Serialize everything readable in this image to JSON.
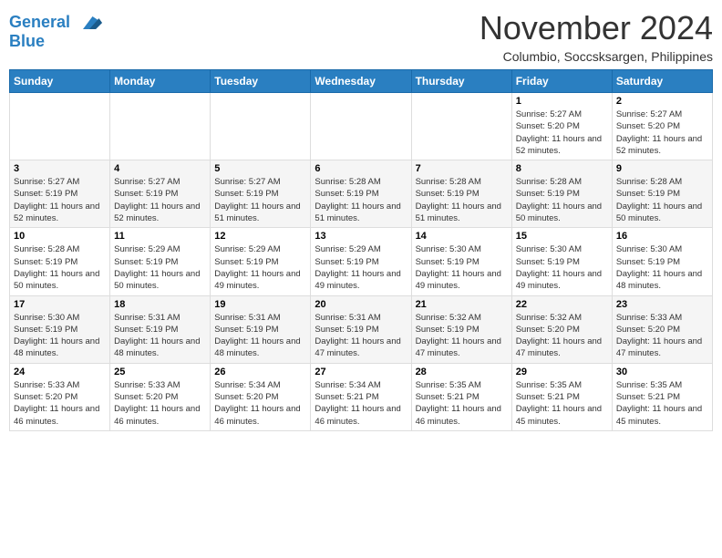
{
  "header": {
    "logo_line1": "General",
    "logo_line2": "Blue",
    "month": "November 2024",
    "location": "Columbio, Soccsksargen, Philippines"
  },
  "weekdays": [
    "Sunday",
    "Monday",
    "Tuesday",
    "Wednesday",
    "Thursday",
    "Friday",
    "Saturday"
  ],
  "weeks": [
    [
      {
        "day": "",
        "info": ""
      },
      {
        "day": "",
        "info": ""
      },
      {
        "day": "",
        "info": ""
      },
      {
        "day": "",
        "info": ""
      },
      {
        "day": "",
        "info": ""
      },
      {
        "day": "1",
        "info": "Sunrise: 5:27 AM\nSunset: 5:20 PM\nDaylight: 11 hours and 52 minutes."
      },
      {
        "day": "2",
        "info": "Sunrise: 5:27 AM\nSunset: 5:20 PM\nDaylight: 11 hours and 52 minutes."
      }
    ],
    [
      {
        "day": "3",
        "info": "Sunrise: 5:27 AM\nSunset: 5:19 PM\nDaylight: 11 hours and 52 minutes."
      },
      {
        "day": "4",
        "info": "Sunrise: 5:27 AM\nSunset: 5:19 PM\nDaylight: 11 hours and 52 minutes."
      },
      {
        "day": "5",
        "info": "Sunrise: 5:27 AM\nSunset: 5:19 PM\nDaylight: 11 hours and 51 minutes."
      },
      {
        "day": "6",
        "info": "Sunrise: 5:28 AM\nSunset: 5:19 PM\nDaylight: 11 hours and 51 minutes."
      },
      {
        "day": "7",
        "info": "Sunrise: 5:28 AM\nSunset: 5:19 PM\nDaylight: 11 hours and 51 minutes."
      },
      {
        "day": "8",
        "info": "Sunrise: 5:28 AM\nSunset: 5:19 PM\nDaylight: 11 hours and 50 minutes."
      },
      {
        "day": "9",
        "info": "Sunrise: 5:28 AM\nSunset: 5:19 PM\nDaylight: 11 hours and 50 minutes."
      }
    ],
    [
      {
        "day": "10",
        "info": "Sunrise: 5:28 AM\nSunset: 5:19 PM\nDaylight: 11 hours and 50 minutes."
      },
      {
        "day": "11",
        "info": "Sunrise: 5:29 AM\nSunset: 5:19 PM\nDaylight: 11 hours and 50 minutes."
      },
      {
        "day": "12",
        "info": "Sunrise: 5:29 AM\nSunset: 5:19 PM\nDaylight: 11 hours and 49 minutes."
      },
      {
        "day": "13",
        "info": "Sunrise: 5:29 AM\nSunset: 5:19 PM\nDaylight: 11 hours and 49 minutes."
      },
      {
        "day": "14",
        "info": "Sunrise: 5:30 AM\nSunset: 5:19 PM\nDaylight: 11 hours and 49 minutes."
      },
      {
        "day": "15",
        "info": "Sunrise: 5:30 AM\nSunset: 5:19 PM\nDaylight: 11 hours and 49 minutes."
      },
      {
        "day": "16",
        "info": "Sunrise: 5:30 AM\nSunset: 5:19 PM\nDaylight: 11 hours and 48 minutes."
      }
    ],
    [
      {
        "day": "17",
        "info": "Sunrise: 5:30 AM\nSunset: 5:19 PM\nDaylight: 11 hours and 48 minutes."
      },
      {
        "day": "18",
        "info": "Sunrise: 5:31 AM\nSunset: 5:19 PM\nDaylight: 11 hours and 48 minutes."
      },
      {
        "day": "19",
        "info": "Sunrise: 5:31 AM\nSunset: 5:19 PM\nDaylight: 11 hours and 48 minutes."
      },
      {
        "day": "20",
        "info": "Sunrise: 5:31 AM\nSunset: 5:19 PM\nDaylight: 11 hours and 47 minutes."
      },
      {
        "day": "21",
        "info": "Sunrise: 5:32 AM\nSunset: 5:19 PM\nDaylight: 11 hours and 47 minutes."
      },
      {
        "day": "22",
        "info": "Sunrise: 5:32 AM\nSunset: 5:20 PM\nDaylight: 11 hours and 47 minutes."
      },
      {
        "day": "23",
        "info": "Sunrise: 5:33 AM\nSunset: 5:20 PM\nDaylight: 11 hours and 47 minutes."
      }
    ],
    [
      {
        "day": "24",
        "info": "Sunrise: 5:33 AM\nSunset: 5:20 PM\nDaylight: 11 hours and 46 minutes."
      },
      {
        "day": "25",
        "info": "Sunrise: 5:33 AM\nSunset: 5:20 PM\nDaylight: 11 hours and 46 minutes."
      },
      {
        "day": "26",
        "info": "Sunrise: 5:34 AM\nSunset: 5:20 PM\nDaylight: 11 hours and 46 minutes."
      },
      {
        "day": "27",
        "info": "Sunrise: 5:34 AM\nSunset: 5:21 PM\nDaylight: 11 hours and 46 minutes."
      },
      {
        "day": "28",
        "info": "Sunrise: 5:35 AM\nSunset: 5:21 PM\nDaylight: 11 hours and 46 minutes."
      },
      {
        "day": "29",
        "info": "Sunrise: 5:35 AM\nSunset: 5:21 PM\nDaylight: 11 hours and 45 minutes."
      },
      {
        "day": "30",
        "info": "Sunrise: 5:35 AM\nSunset: 5:21 PM\nDaylight: 11 hours and 45 minutes."
      }
    ]
  ]
}
